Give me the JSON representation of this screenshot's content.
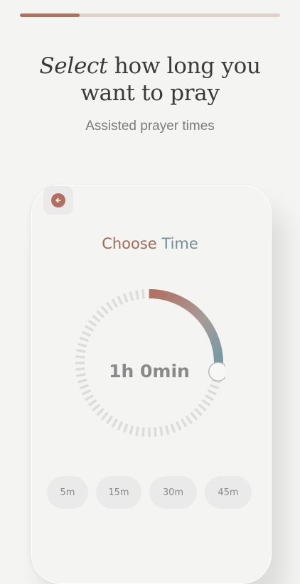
{
  "progress": {
    "fraction": 0.23
  },
  "header": {
    "title_italic": "Select",
    "title_rest_line1": " how long you",
    "title_line2": "want to pray",
    "subtitle": "Assisted prayer times"
  },
  "card": {
    "title_part1": "Choose ",
    "title_part2": "Time",
    "back_icon": "arrow-left-icon",
    "selected_time": "1h 0min",
    "dial_fraction": 0.25,
    "presets": [
      "5m",
      "15m",
      "30m",
      "45m"
    ]
  },
  "colors": {
    "accent": "#b36e5e",
    "accent_teal": "#6f9aa5",
    "progress_track": "#e3cfc9",
    "background": "#f4f4f3"
  }
}
